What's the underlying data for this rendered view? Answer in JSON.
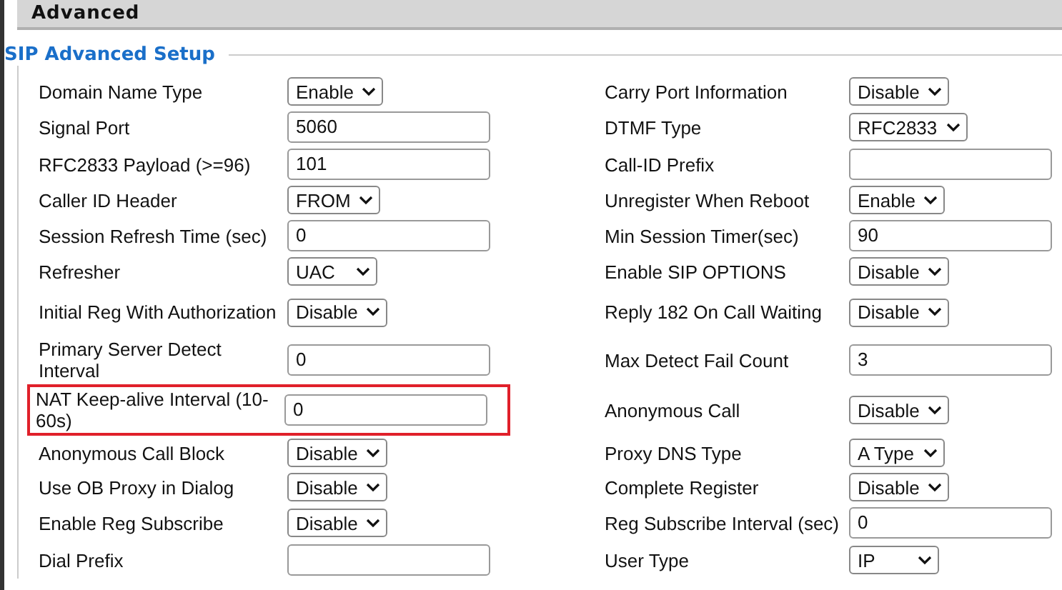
{
  "header": {
    "title": "Advanced"
  },
  "section": {
    "title": "SIP Advanced Setup"
  },
  "rows": [
    {
      "left": {
        "label": "Domain Name Type",
        "kind": "select",
        "value": "Enable",
        "highlighted": false
      },
      "right": {
        "label": "Carry Port Information",
        "kind": "select",
        "value": "Disable"
      }
    },
    {
      "left": {
        "label": "Signal Port",
        "kind": "input",
        "value": "5060",
        "highlighted": false
      },
      "right": {
        "label": "DTMF Type",
        "kind": "select",
        "value": "RFC2833"
      }
    },
    {
      "left": {
        "label": "RFC2833 Payload (>=96)",
        "kind": "input",
        "value": "101",
        "highlighted": false
      },
      "right": {
        "label": "Call-ID Prefix",
        "kind": "input"
      }
    },
    {
      "left": {
        "label": "Caller ID Header",
        "kind": "select",
        "value": "FROM",
        "highlighted": false
      },
      "right": {
        "label": "Unregister When Reboot",
        "kind": "select",
        "value": "Enable"
      }
    },
    {
      "left": {
        "label": "Session Refresh Time (sec)",
        "kind": "input",
        "value": "0",
        "highlighted": false
      },
      "right": {
        "label": "Min Session Timer(sec)",
        "kind": "input",
        "value": "90"
      }
    },
    {
      "left": {
        "label": "Refresher",
        "kind": "select",
        "value": "UAC",
        "highlighted": false
      },
      "right": {
        "label": "Enable SIP OPTIONS",
        "kind": "select",
        "value": "Disable"
      }
    },
    {
      "left": {
        "label": "Initial Reg With Authorization",
        "kind": "select",
        "value": "Disable",
        "highlighted": false
      },
      "right": {
        "label": "Reply 182 On Call Waiting",
        "kind": "select",
        "value": "Disable"
      }
    },
    {
      "left": {
        "label": "Primary Server Detect Interval",
        "kind": "input",
        "value": "0",
        "highlighted": false
      },
      "right": {
        "label": "Max Detect Fail Count",
        "kind": "input",
        "value": "3"
      }
    },
    {
      "left": {
        "label": "NAT Keep-alive Interval (10-60s)",
        "kind": "input",
        "value": "0",
        "highlighted": true
      },
      "right": {
        "label": "Anonymous Call",
        "kind": "select",
        "value": "Disable"
      }
    },
    {
      "left": {
        "label": "Anonymous Call Block",
        "kind": "select",
        "value": "Disable",
        "highlighted": false
      },
      "right": {
        "label": "Proxy DNS Type",
        "kind": "select",
        "value": "A Type"
      }
    },
    {
      "left": {
        "label": "Use OB Proxy in Dialog",
        "kind": "select",
        "value": "Disable",
        "highlighted": false
      },
      "right": {
        "label": "Complete Register",
        "kind": "select",
        "value": "Disable"
      }
    },
    {
      "left": {
        "label": "Enable Reg Subscribe",
        "kind": "select",
        "value": "Disable",
        "highlighted": false
      },
      "right": {
        "label": "Reg Subscribe Interval (sec)",
        "kind": "input",
        "value": "0"
      }
    },
    {
      "left": {
        "label": "Dial Prefix",
        "kind": "input",
        "highlighted": false
      },
      "right": {
        "label": "User Type",
        "kind": "select",
        "value": "IP"
      }
    }
  ]
}
